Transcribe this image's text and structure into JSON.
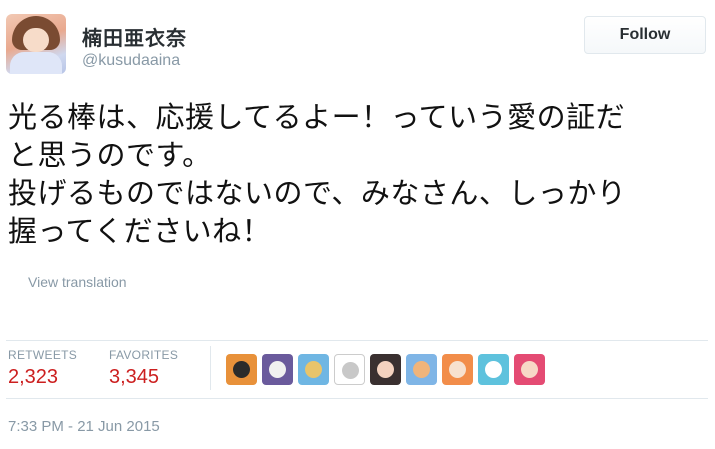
{
  "user": {
    "display_name": "楠田亜衣奈",
    "handle": "@kusudaaina"
  },
  "follow_button": {
    "label": "Follow"
  },
  "tweet": {
    "lines": [
      "光る棒は、応援してるよー！っていう愛の証だ",
      "と思うのです。",
      "投げるものではないので、みなさん、しっかり",
      "握ってくださいね！"
    ],
    "translate_link": "View translation"
  },
  "stats": {
    "retweets_label": "RETWEETS",
    "retweets_count": "2,323",
    "favorites_label": "FAVORITES",
    "favorites_count": "3,345"
  },
  "favoriters": [
    {
      "icon": "orange-avatar",
      "bg": "#e8913a",
      "fg": "#2b2b2b"
    },
    {
      "icon": "anime-avatar",
      "bg": "#6a5a9c",
      "fg": "#f0f0f0"
    },
    {
      "icon": "anime-avatar",
      "bg": "#6fb6e3",
      "fg": "#e8c46b"
    },
    {
      "icon": "default-avatar",
      "bg": "#ffffff",
      "fg": "#c8c8c8"
    },
    {
      "icon": "anime-avatar",
      "bg": "#3a3030",
      "fg": "#f4d2bf"
    },
    {
      "icon": "anime-avatar",
      "bg": "#7fb5e6",
      "fg": "#f0b47a"
    },
    {
      "icon": "anime-avatar",
      "bg": "#f28d4a",
      "fg": "#f7e1cf"
    },
    {
      "icon": "anime-avatar",
      "bg": "#5ec2dd",
      "fg": "#ffffff"
    },
    {
      "icon": "anime-avatar",
      "bg": "#e44b73",
      "fg": "#f7d8c6"
    }
  ],
  "timestamp": "7:33 PM - 21 Jun 2015"
}
